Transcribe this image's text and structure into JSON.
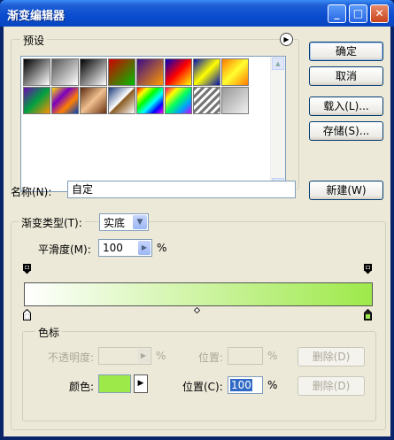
{
  "window": {
    "title": "渐变编辑器",
    "min": "_",
    "max": "□",
    "close": "✕"
  },
  "presets": {
    "label": "预设",
    "menu_icon": "circle-arrow-icon",
    "swatches": [
      {
        "name": "foreground-to-background",
        "bg": "linear-gradient(135deg,#000 0%,#fff 100%)"
      },
      {
        "name": "foreground-to-transparent",
        "bg": "linear-gradient(135deg,#555 0%,rgba(255,255,255,0) 100%)"
      },
      {
        "name": "black-white",
        "bg": "linear-gradient(135deg,#000 0%,#fff 100%)"
      },
      {
        "name": "red-green",
        "bg": "linear-gradient(135deg,#d00000 0%,#00c000 100%)"
      },
      {
        "name": "violet-orange",
        "bg": "linear-gradient(135deg,#3a0a8a 0%,#ff9a00 100%)"
      },
      {
        "name": "blue-red-yellow",
        "bg": "linear-gradient(135deg,#0000c0 0%,#ff0000 50%,#ffff00 100%)"
      },
      {
        "name": "blue-yellow-blue",
        "bg": "linear-gradient(135deg,#0010b0 0%,#ffff00 50%,#0010b0 100%)"
      },
      {
        "name": "orange-yellow-orange",
        "bg": "linear-gradient(135deg,#ff7a00 0%,#ffff30 50%,#ff7a00 100%)"
      },
      {
        "name": "violet-green-orange",
        "bg": "linear-gradient(135deg,#6a0ab0 0%,#00a040 50%,#ff9000 100%)"
      },
      {
        "name": "yellow-violet-orange-blue",
        "bg": "linear-gradient(135deg,#ffe000 0%,#7a00c0 35%,#ff8000 65%,#0040c0 100%)"
      },
      {
        "name": "copper",
        "bg": "linear-gradient(135deg,#5a2a10 0%,#f0c090 50%,#6a3010 100%)"
      },
      {
        "name": "chrome",
        "bg": "linear-gradient(135deg,#1a3a7a 0%,#ffffff 48%,#8a5a20 52%,#ffffff 100%)"
      },
      {
        "name": "spectrum",
        "bg": "linear-gradient(135deg,#ff0000,#ffff00,#00ff00,#00ffff,#0000ff,#ff00ff)"
      },
      {
        "name": "transparent-rainbow",
        "bg": "linear-gradient(135deg,#ff0060,#ffff00,#00ff60,#00a0ff,#d000ff)"
      },
      {
        "name": "transparent-stripes",
        "bg": "repeating-linear-gradient(135deg,#777 0 3px,#fff 3px 6px)"
      },
      {
        "name": "neutral-density",
        "bg": "linear-gradient(135deg,#999 0%,#f0f0f0 100%)"
      }
    ]
  },
  "buttons": {
    "ok": "确定",
    "cancel": "取消",
    "load": "载入(L)...",
    "save": "存储(S)...",
    "new": "新建(W)"
  },
  "name": {
    "label": "名称(N):",
    "value": "自定"
  },
  "gradient": {
    "group_label": "渐变类型(T):",
    "type": "实底",
    "smooth_label": "平滑度(M):",
    "smooth_value": "100",
    "smooth_unit": "%",
    "colors": {
      "start": "#ffffff",
      "end": "#9ee94a"
    }
  },
  "stops": {
    "group_label": "色标",
    "opacity_label": "不透明度:",
    "opacity_value": "",
    "opacity_unit": "%",
    "opacity_position_label": "位置:",
    "opacity_position_value": "",
    "opacity_position_unit": "%",
    "delete_label": "删除(D)",
    "color_label": "颜色:",
    "color_value": "#9ee94a",
    "color_position_label": "位置(C):",
    "color_position_value": "100",
    "color_position_unit": "%",
    "delete_label2": "删除(D)"
  }
}
